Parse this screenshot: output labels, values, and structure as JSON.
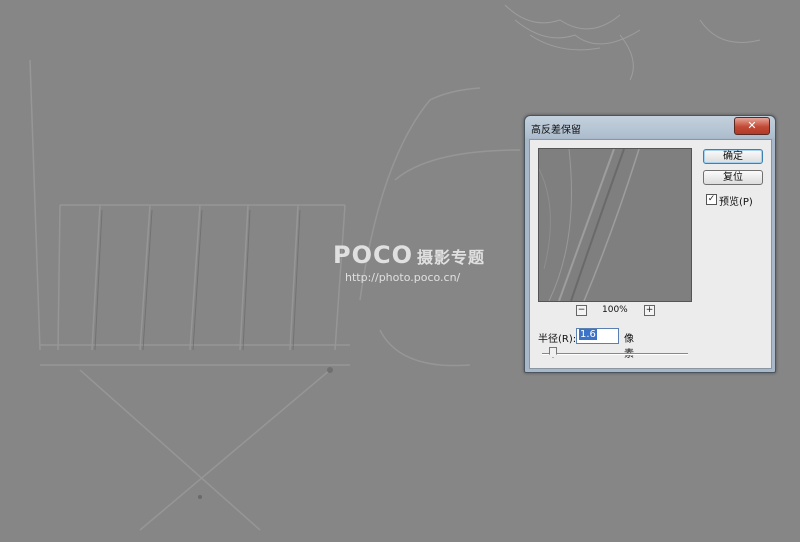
{
  "watermark": {
    "logo": "POCO",
    "logo_cn": "摄影专题",
    "url": "http://photo.poco.cn/"
  },
  "dialog": {
    "title": "高反差保留",
    "close_glyph": "✕",
    "ok_label": "确定",
    "reset_label": "复位",
    "preview_label": "预览(P)",
    "preview_checked": true,
    "zoom_minus": "−",
    "zoom_plus": "+",
    "zoom_value": "100%",
    "radius_label": "半径(R):",
    "radius_value": "1.6",
    "radius_unit": "像素"
  },
  "colors": {
    "background": "#868686",
    "title_bar": "#b6c4d2",
    "close_button": "#c24a36",
    "selection": "#3b73c8"
  }
}
